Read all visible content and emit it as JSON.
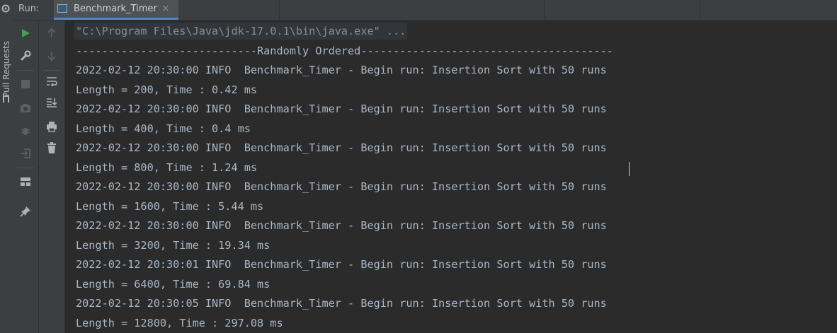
{
  "header": {
    "run_label": "Run:",
    "tab_title": "Benchmark_Timer",
    "tab_close": "×"
  },
  "sidebar": {
    "vertical_tab_label": "Pull Requests"
  },
  "console": {
    "command": "\"C:\\Program Files\\Java\\jdk-17.0.1\\bin\\java.exe\" ...",
    "lines": [
      "----------------------------Randomly Ordered---------------------------------------",
      "2022-02-12 20:30:00 INFO  Benchmark_Timer - Begin run: Insertion Sort with 50 runs",
      "Length = 200, Time : 0.42 ms",
      "2022-02-12 20:30:00 INFO  Benchmark_Timer - Begin run: Insertion Sort with 50 runs",
      "Length = 400, Time : 0.4 ms",
      "2022-02-12 20:30:00 INFO  Benchmark_Timer - Begin run: Insertion Sort with 50 runs",
      "Length = 800, Time : 1.24 ms",
      "2022-02-12 20:30:00 INFO  Benchmark_Timer - Begin run: Insertion Sort with 50 runs",
      "Length = 1600, Time : 5.44 ms",
      "2022-02-12 20:30:00 INFO  Benchmark_Timer - Begin run: Insertion Sort with 50 runs",
      "Length = 3200, Time : 19.34 ms",
      "2022-02-12 20:30:01 INFO  Benchmark_Timer - Begin run: Insertion Sort with 50 runs",
      "Length = 6400, Time : 69.84 ms",
      "2022-02-12 20:30:05 INFO  Benchmark_Timer - Begin run: Insertion Sort with 50 runs",
      "Length = 12800, Time : 297.08 ms"
    ]
  },
  "toolbar_icons": {
    "gutter_a": [
      "run-icon",
      "wrench-icon",
      "stop-icon",
      "camera-icon",
      "debug-bug-icon",
      "login-exit-icon",
      "layout-icon",
      "pin-icon"
    ],
    "gutter_b": [
      "up-arrow-icon",
      "down-arrow-icon",
      "soft-wrap-icon",
      "scroll-to-end-icon",
      "print-icon",
      "trash-icon"
    ]
  },
  "colors": {
    "console_bg": "#2b2b2b",
    "panel_bg": "#3c3f41",
    "text": "#a9b7c6",
    "run_green": "#499c54",
    "tab_underline": "#4a88c7"
  }
}
